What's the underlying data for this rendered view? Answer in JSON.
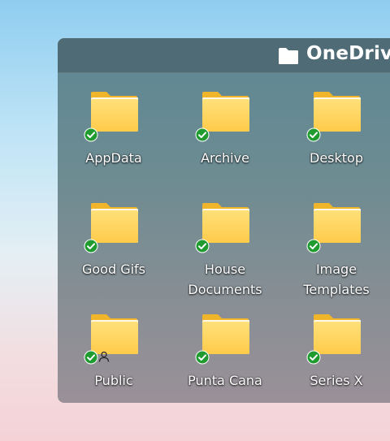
{
  "header": {
    "title": "OneDrive",
    "icon": "folder-icon"
  },
  "folders": [
    {
      "name": "AppData",
      "status": "synced"
    },
    {
      "name": "Archive",
      "status": "synced"
    },
    {
      "name": "Desktop",
      "status": "synced"
    },
    {
      "name": "Good Gifs",
      "status": "synced"
    },
    {
      "name": "House Documents",
      "status": "synced"
    },
    {
      "name": "Image Templates",
      "status": "synced"
    },
    {
      "name": "Public",
      "status": "synced",
      "shared": true
    },
    {
      "name": "Punta Cana",
      "status": "synced"
    },
    {
      "name": "Series X",
      "status": "synced"
    }
  ],
  "colors": {
    "folder_front": "#ffd25a",
    "folder_back": "#f1b52c",
    "synced_badge": "#1f9b2f"
  }
}
